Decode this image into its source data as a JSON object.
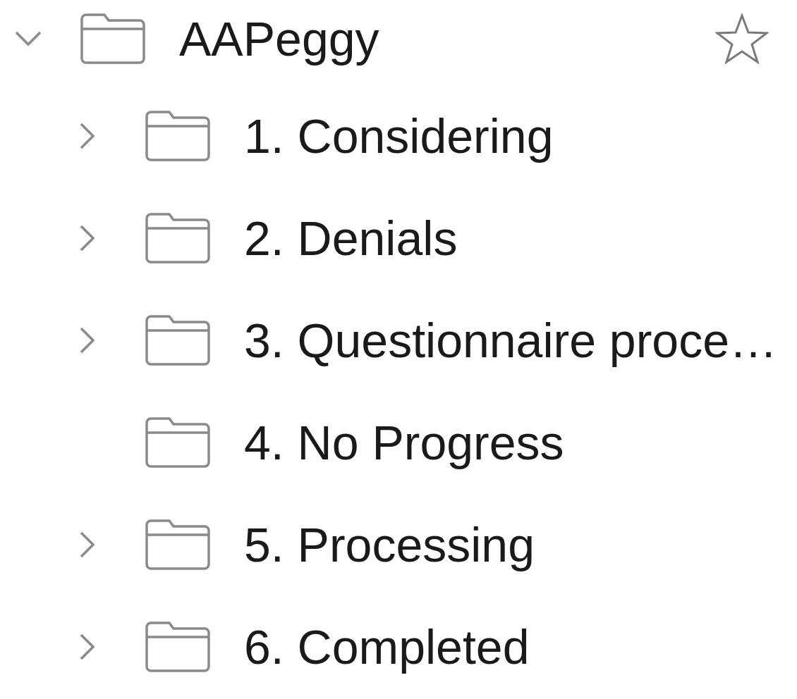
{
  "tree": {
    "label": "AAPeggy",
    "expanded": true,
    "starred": false,
    "children": [
      {
        "label": "1. Considering",
        "expandable": true
      },
      {
        "label": "2. Denials",
        "expandable": true
      },
      {
        "label": "3. Questionnaire proce…",
        "expandable": true
      },
      {
        "label": "4. No Progress",
        "expandable": false
      },
      {
        "label": "5. Processing",
        "expandable": true
      },
      {
        "label": "6. Completed",
        "expandable": true
      }
    ]
  }
}
